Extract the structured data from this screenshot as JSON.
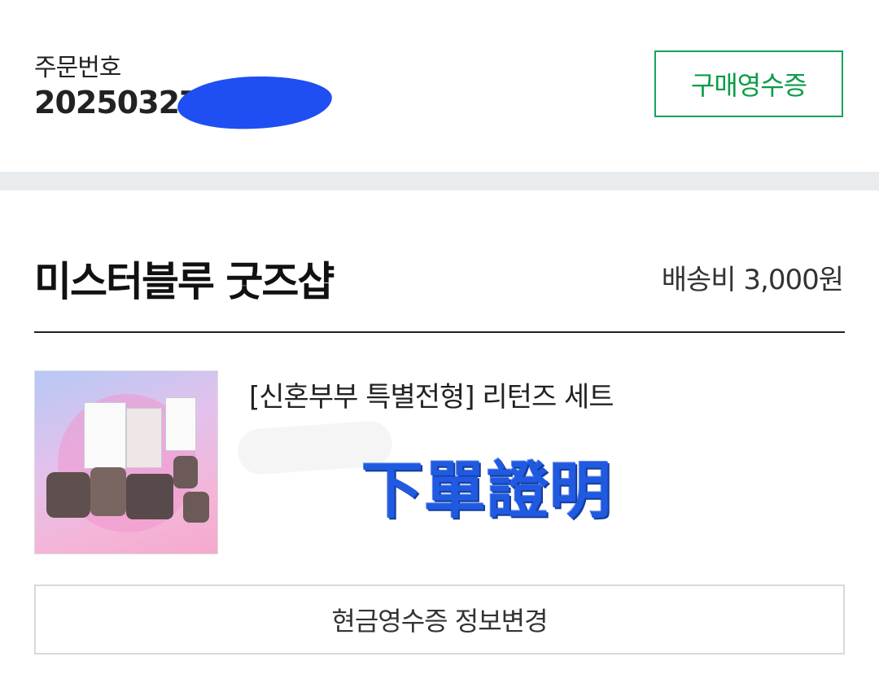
{
  "order": {
    "label": "주문번호",
    "number_visible": "20250327",
    "receipt_button": "구매영수증"
  },
  "shop": {
    "name": "미스터블루 굿즈샵",
    "shipping_fee": "배송비 3,000원"
  },
  "product": {
    "name": "[신혼부부 특별전형] 리턴즈 세트",
    "stamp_text": "下單證明"
  },
  "cash_receipt_button": "현금영수증 정보변경",
  "colors": {
    "accent_green": "#0a9c47",
    "redaction_blue": "#1f4ff2",
    "stamp_blue": "#1f5ae0"
  }
}
